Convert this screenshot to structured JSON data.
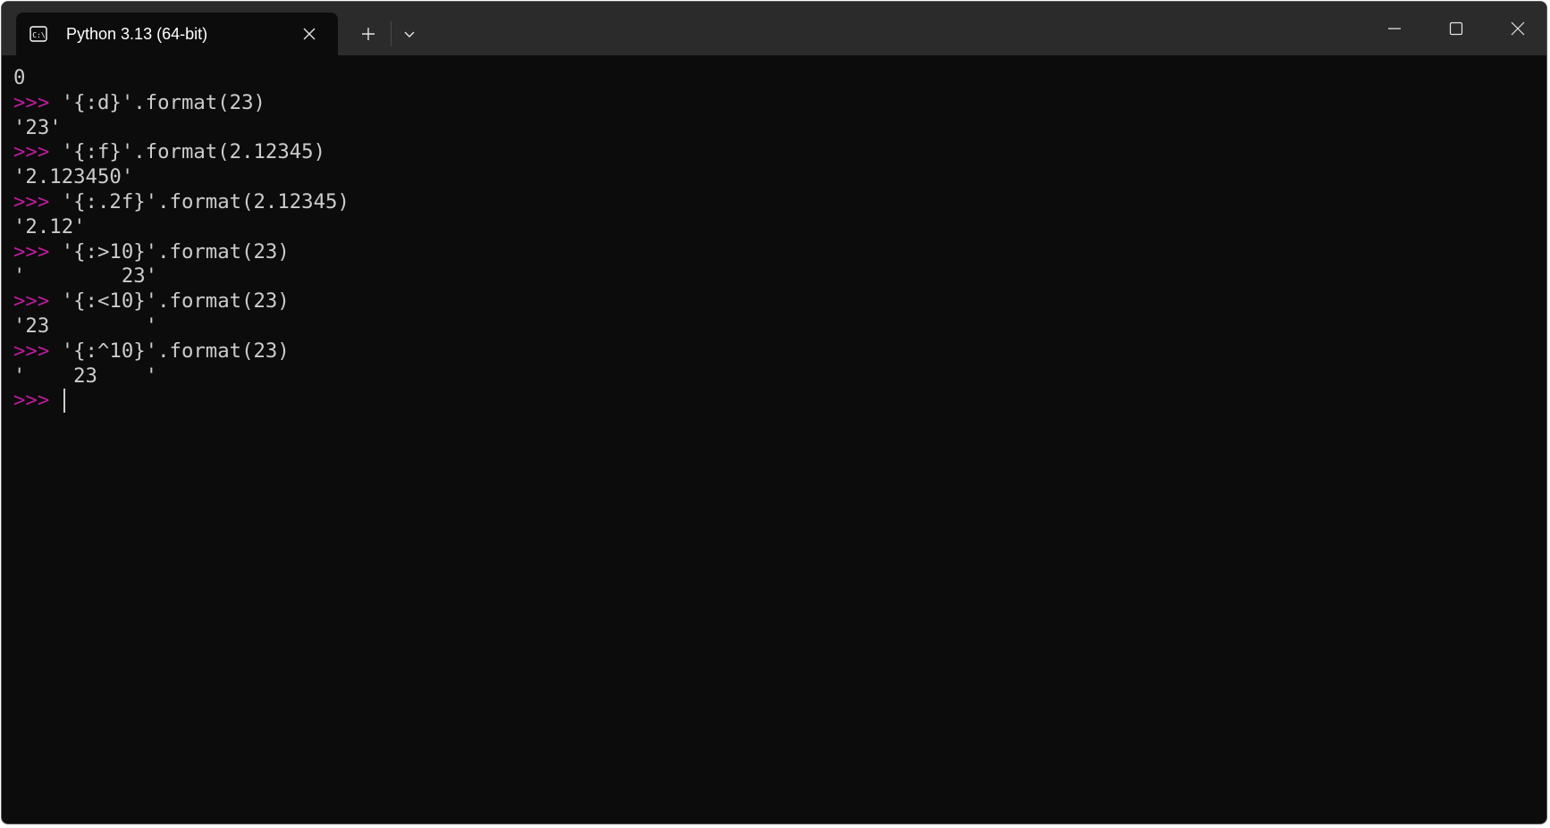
{
  "window": {
    "tab_title": "Python 3.13 (64-bit)",
    "tab_icon": "cmd-terminal-icon",
    "new_tab_icon": "plus-icon",
    "dropdown_icon": "chevron-down-icon"
  },
  "colors": {
    "background": "#0c0c0c",
    "foreground": "#cccccc",
    "prompt": "#c01c9f",
    "titlebar": "#2b2b2b"
  },
  "terminal": {
    "lines": [
      {
        "prompt": "",
        "text": "0"
      },
      {
        "prompt": ">>>",
        "text": " '{:d}'.format(23)"
      },
      {
        "prompt": "",
        "text": "'23'"
      },
      {
        "prompt": ">>>",
        "text": " '{:f}'.format(2.12345)"
      },
      {
        "prompt": "",
        "text": "'2.123450'"
      },
      {
        "prompt": ">>>",
        "text": " '{:.2f}'.format(2.12345)"
      },
      {
        "prompt": "",
        "text": "'2.12'"
      },
      {
        "prompt": ">>>",
        "text": " '{:>10}'.format(23)"
      },
      {
        "prompt": "",
        "text": "'        23'"
      },
      {
        "prompt": ">>>",
        "text": " '{:<10}'.format(23)"
      },
      {
        "prompt": "",
        "text": "'23        '"
      },
      {
        "prompt": ">>>",
        "text": " '{:^10}'.format(23)"
      },
      {
        "prompt": "",
        "text": "'    23    '"
      },
      {
        "prompt": ">>>",
        "text": " "
      }
    ]
  }
}
